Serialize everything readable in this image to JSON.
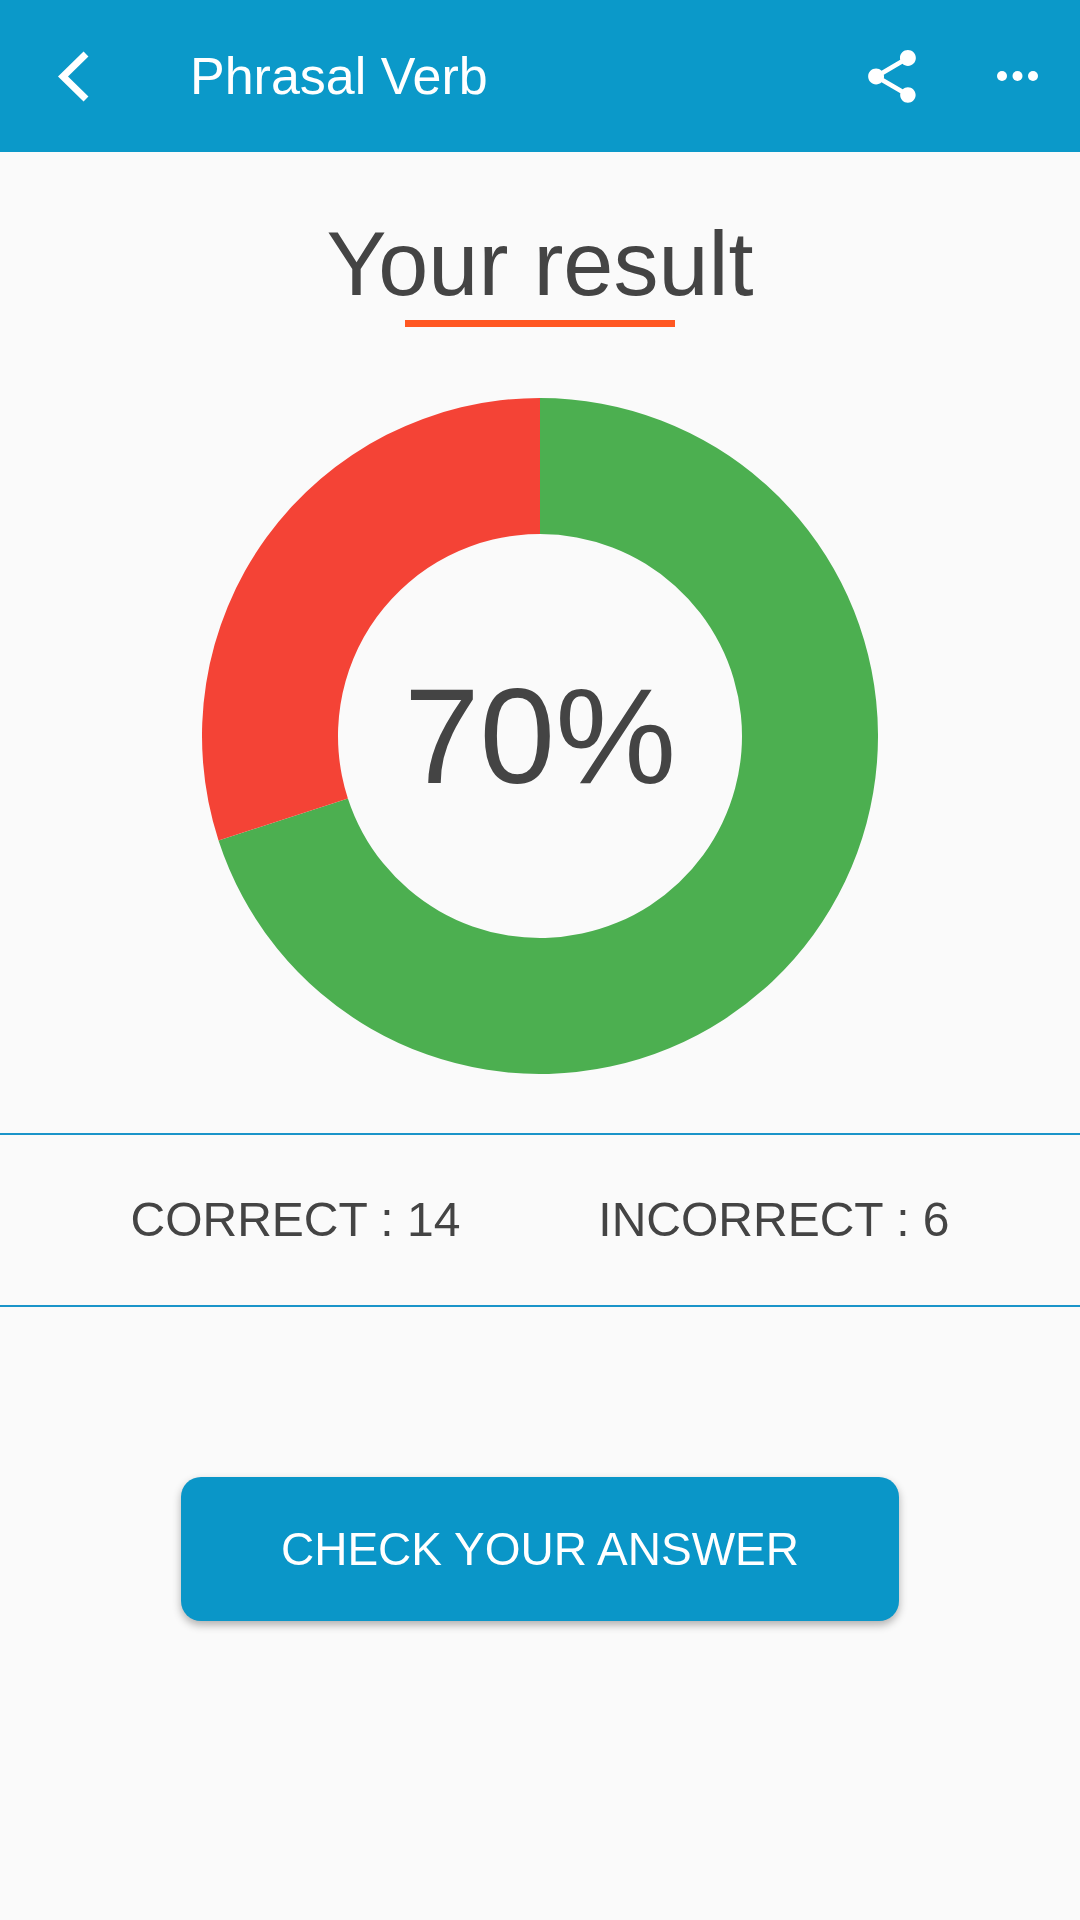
{
  "app_bar": {
    "title": "Phrasal Verb"
  },
  "heading": "Your result",
  "result": {
    "percent_label": "70%",
    "chart_data": {
      "type": "donut",
      "values": [
        70,
        30
      ],
      "colors": [
        "#4caf50",
        "#f44336"
      ]
    }
  },
  "stats": [
    "CORRECT : 14",
    "INCORRECT : 6"
  ],
  "button": {
    "label": "CHECK YOUR ANSWER"
  }
}
